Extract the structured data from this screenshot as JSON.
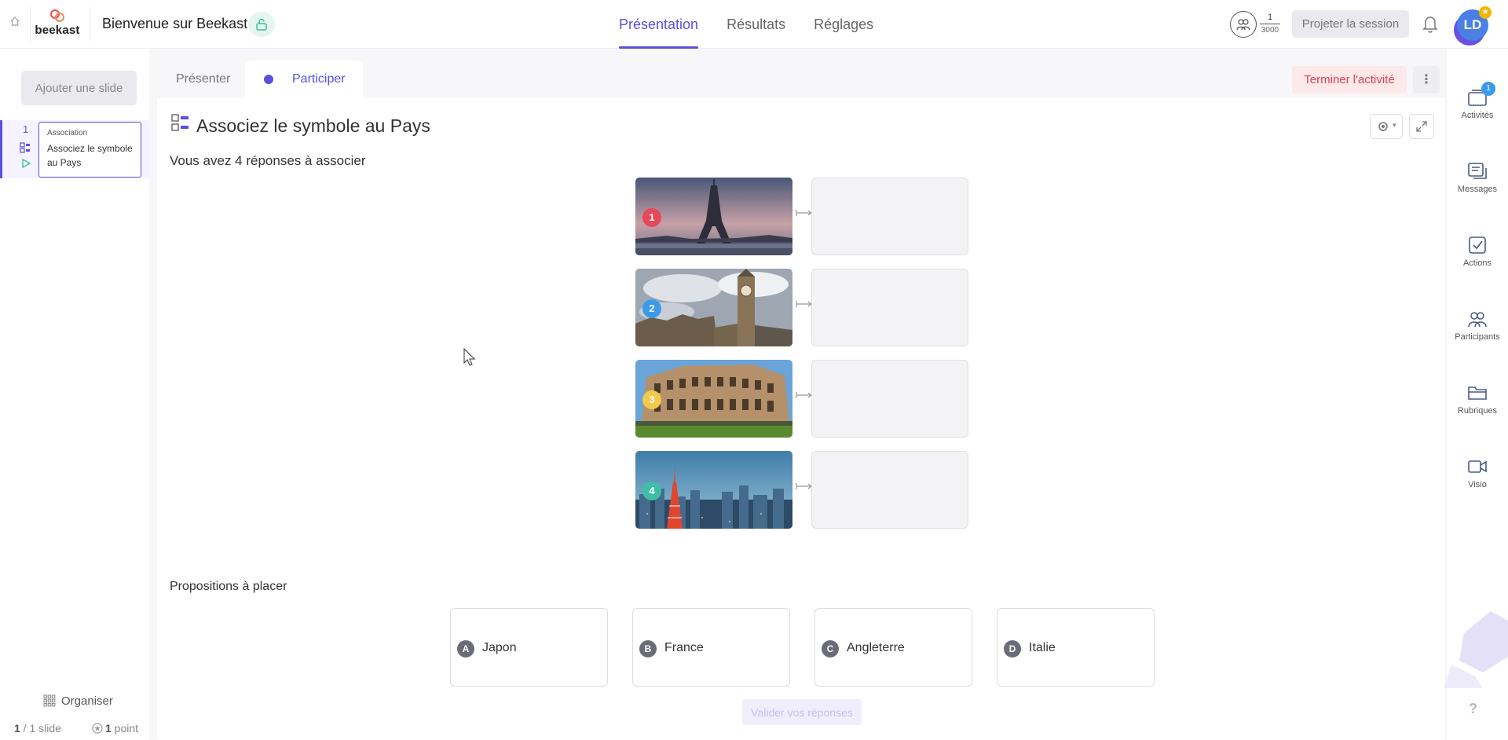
{
  "header": {
    "logo_text": "beekast",
    "session_title": "Bienvenue sur Beekast",
    "nav": [
      "Présentation",
      "Résultats",
      "Réglages"
    ],
    "participants_count": "1",
    "participants_max": "3000",
    "project_label": "Projeter la session",
    "avatar_initials": "LD"
  },
  "left": {
    "add_slide": "Ajouter une slide",
    "slide": {
      "number": "1",
      "kind": "Association",
      "title": "Associez le symbole au Pays"
    },
    "organize": "Organiser",
    "slide_counter_current": "1",
    "slide_counter_rest": " / 1 slide",
    "points_value": "1",
    "points_rest": " point"
  },
  "main": {
    "tab_present": "Présenter",
    "tab_participate": "Participer",
    "end_label": "Terminer l'activité",
    "question_title": "Associez le symbole au Pays",
    "answers_count": "Vous avez 4 réponses à associer",
    "pairs": [
      {
        "num": "1",
        "badge_color": "#e8475a",
        "scene": "eiffel"
      },
      {
        "num": "2",
        "badge_color": "#3b9bea",
        "scene": "bigben"
      },
      {
        "num": "3",
        "badge_color": "#f2c94c",
        "scene": "colosseum"
      },
      {
        "num": "4",
        "badge_color": "#3dbfa5",
        "scene": "tokyo"
      }
    ],
    "props_label": "Propositions à placer",
    "propositions": [
      {
        "letter": "A",
        "label": "Japon"
      },
      {
        "letter": "B",
        "label": "France"
      },
      {
        "letter": "C",
        "label": "Angleterre"
      },
      {
        "letter": "D",
        "label": "Italie"
      }
    ],
    "validate_label": "Valider vos réponses"
  },
  "rail": {
    "activities": "Activités",
    "activities_badge": "1",
    "messages": "Messages",
    "actions": "Actions",
    "participants": "Participants",
    "rubriques": "Rubriques",
    "visio": "Visio",
    "help": "?"
  },
  "colors": {
    "accent": "#5b4fe0",
    "danger": "#e0414d"
  }
}
